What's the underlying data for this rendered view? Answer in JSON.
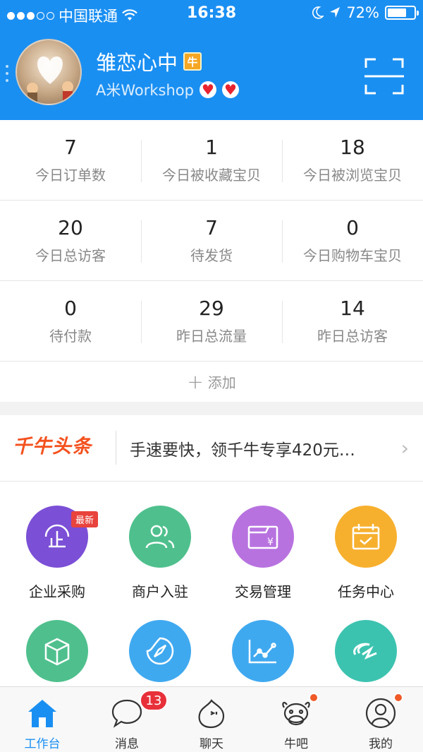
{
  "status_bar": {
    "carrier": "中国联通",
    "time": "16:38",
    "battery": "72%",
    "battery_level": 0.72
  },
  "profile": {
    "shop_name": "雏恋心中",
    "badge": "牛",
    "subtitle": "A米Workshop"
  },
  "stats": [
    {
      "value": "7",
      "label": "今日订单数"
    },
    {
      "value": "1",
      "label": "今日被收藏宝贝"
    },
    {
      "value": "18",
      "label": "今日被浏览宝贝"
    },
    {
      "value": "20",
      "label": "今日总访客"
    },
    {
      "value": "7",
      "label": "待发货"
    },
    {
      "value": "0",
      "label": "今日购物车宝贝"
    },
    {
      "value": "0",
      "label": "待付款"
    },
    {
      "value": "29",
      "label": "昨日总流量"
    },
    {
      "value": "14",
      "label": "昨日总访客"
    }
  ],
  "add_label": "添加",
  "headline": {
    "logo": "千牛头条",
    "text": "手速要快，领千牛专享420元…"
  },
  "apps": [
    {
      "label": "企业采购",
      "color": "#7b4fd6",
      "icon": "enterprise-icon",
      "tag": "最新"
    },
    {
      "label": "商户入驻",
      "color": "#4fc08d",
      "icon": "merchants-icon"
    },
    {
      "label": "交易管理",
      "color": "#b872e0",
      "icon": "trade-icon"
    },
    {
      "label": "任务中心",
      "color": "#f7b02e",
      "icon": "task-icon"
    },
    {
      "label": "",
      "color": "#4fc08d",
      "icon": "package-icon"
    },
    {
      "label": "",
      "color": "#3fa9f0",
      "icon": "compass-icon"
    },
    {
      "label": "",
      "color": "#3fa9f0",
      "icon": "chart-icon"
    },
    {
      "label": "",
      "color": "#3cc3b0",
      "icon": "alibaba-icon"
    }
  ],
  "tabs": [
    {
      "label": "工作台",
      "icon": "home-icon",
      "active": true
    },
    {
      "label": "消息",
      "icon": "message-icon",
      "badge": "13"
    },
    {
      "label": "聊天",
      "icon": "chat-icon"
    },
    {
      "label": "牛吧",
      "icon": "cow-icon",
      "dot": true
    },
    {
      "label": "我的",
      "icon": "user-icon",
      "dot": true
    }
  ],
  "colors": {
    "header": "#1a8ff2",
    "accent": "#1a8ff2",
    "badge_red": "#e8303a"
  }
}
